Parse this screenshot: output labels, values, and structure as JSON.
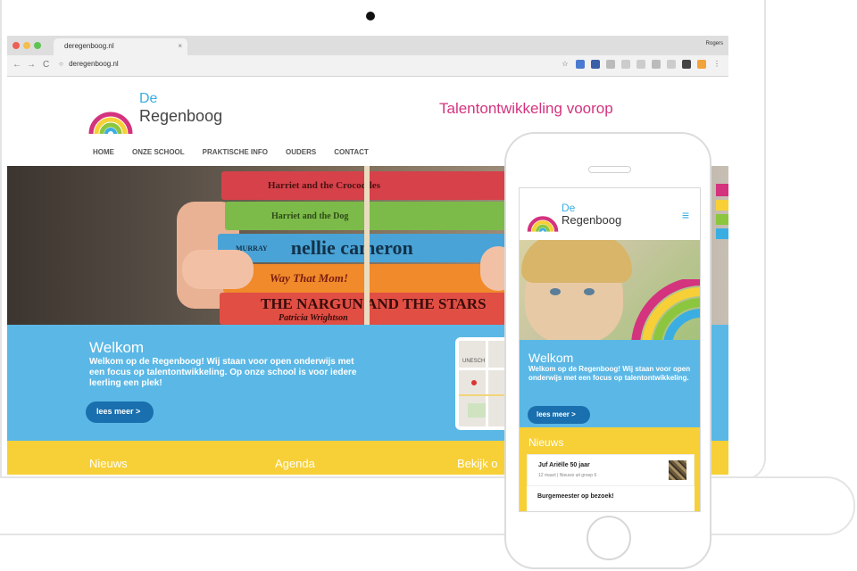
{
  "browser": {
    "tab_title": "deregenboog.nl",
    "tab_close": "×",
    "profile": "Rogers",
    "url": "deregenboog.nl",
    "nav": {
      "back": "←",
      "forward": "→",
      "reload": "C"
    }
  },
  "site": {
    "logo_de": "De",
    "logo_name": "Regenboog",
    "tagline": "Talentontwikkeling voorop",
    "nav": [
      "HOME",
      "ONZE SCHOOL",
      "PRAKTISCHE INFO",
      "OUDERS",
      "CONTACT"
    ],
    "hero_books": [
      {
        "author": "",
        "title": "Harriet and the Crocodiles",
        "color": "#d6414a"
      },
      {
        "author": "",
        "title": "Harriet and the Dog",
        "color": "#7cbb4a"
      },
      {
        "author": "MURRAY",
        "title": "nellie cameron",
        "color": "#4aa3d6"
      },
      {
        "author": "",
        "title": "Way That Mom!",
        "color": "#f08a2a"
      },
      {
        "author": "",
        "title": "THE NARGUN AND THE STARS",
        "color": "#e04e44"
      }
    ],
    "hero_author": "Patricia Wrightson",
    "welcome_title": "Welkom",
    "welcome_text": "Welkom op de Regenboog! Wij staan voor open onderwijs met een focus op talentontwikkeling. Op onze school is voor iedere leerling een plek!",
    "read_more": "lees meer >",
    "map_label": "UNESCH",
    "columns": [
      "Nieuws",
      "Agenda",
      "Bekijk o"
    ]
  },
  "phone": {
    "logo_de": "De",
    "logo_name": "Regenboog",
    "menu_icon": "≡",
    "welcome_title": "Welkom",
    "welcome_text": "Welkom op de Regenboog! Wij staan voor open onderwijs met een focus op talentontwikkeling.",
    "read_more": "lees meer >",
    "news_title": "Nieuws",
    "news": [
      {
        "title": "Juf Ariëlle 50 jaar",
        "meta": "12 maart  |  Nieuws uit groep 6"
      },
      {
        "title": "Burgemeester op bezoek!"
      }
    ]
  },
  "colors": {
    "blue": "#5bb8e6",
    "dark_blue": "#1a6fae",
    "yellow": "#f7d038",
    "magenta": "#d4337e"
  }
}
